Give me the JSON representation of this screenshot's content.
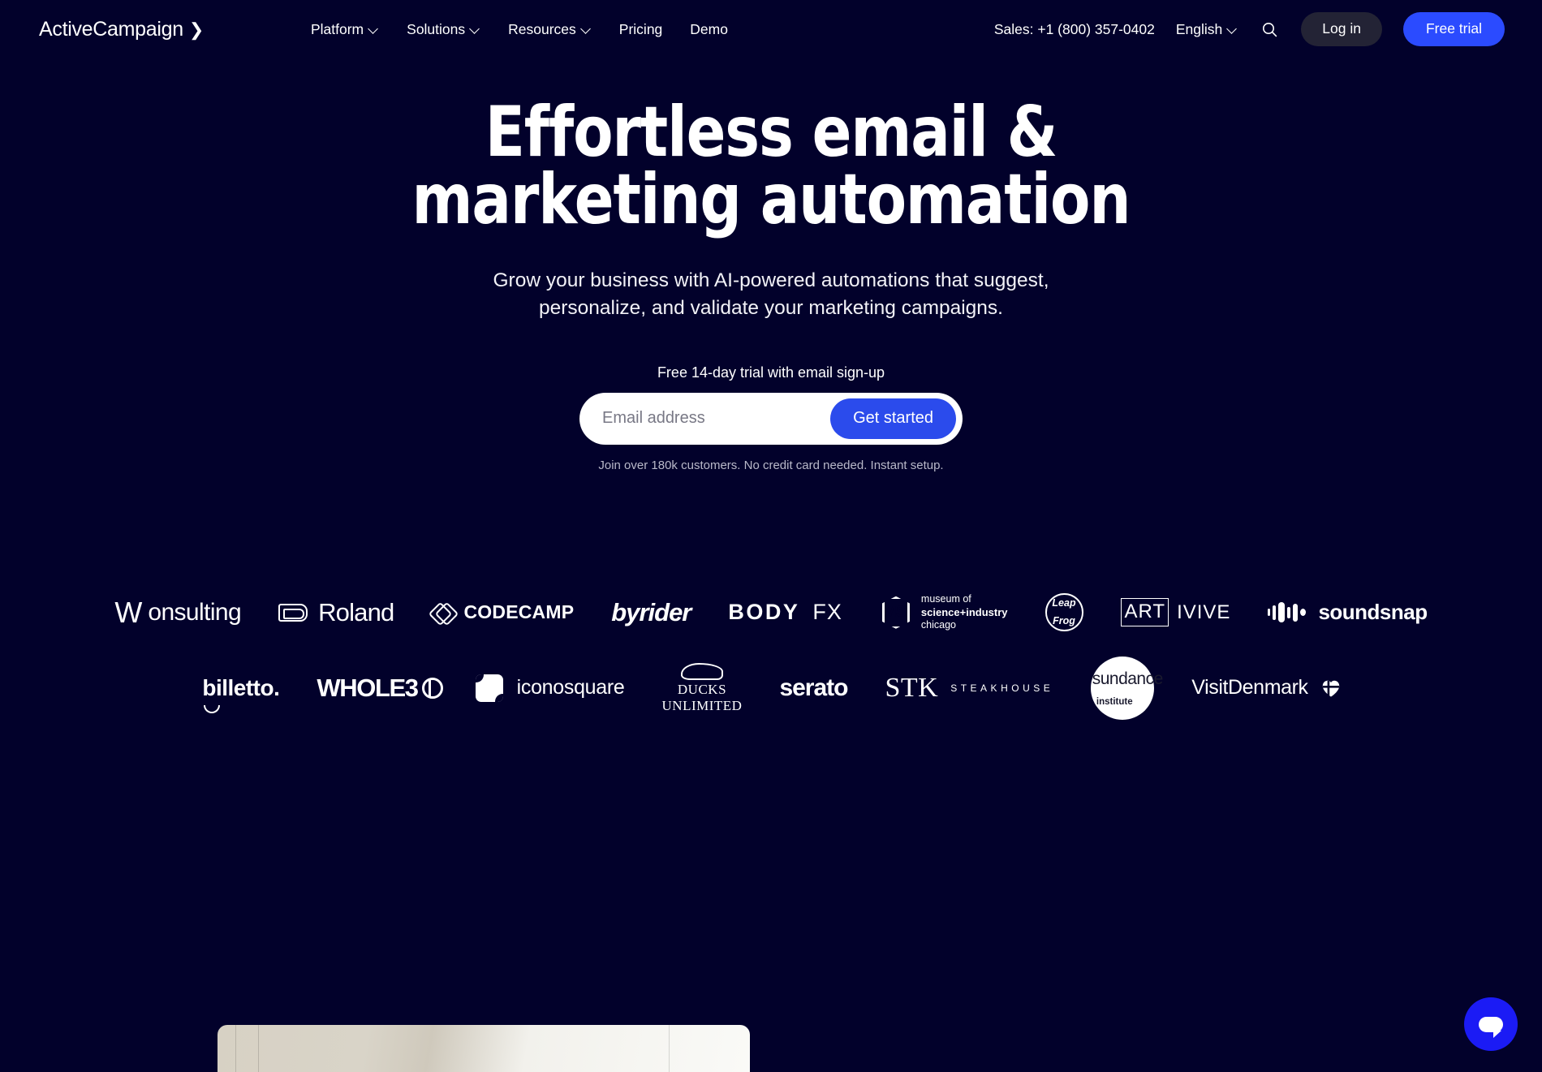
{
  "header": {
    "brand": "ActiveCampaign",
    "brand_chevron": "❯",
    "nav": [
      {
        "label": "Platform",
        "has_caret": true
      },
      {
        "label": "Solutions",
        "has_caret": true
      },
      {
        "label": "Resources",
        "has_caret": true
      },
      {
        "label": "Pricing",
        "has_caret": false
      },
      {
        "label": "Demo",
        "has_caret": false
      }
    ],
    "sales_phone": "Sales: +1 (800) 357-0402",
    "language": "English",
    "search_icon": "search-icon",
    "login_label": "Log in",
    "free_trial_label": "Free trial"
  },
  "hero": {
    "title": "Effortless email & marketing automation",
    "subtitle": "Grow your business with AI-powered automations that suggest, personalize, and validate your marketing campaigns."
  },
  "signup": {
    "label": "Free 14-day trial with email sign-up",
    "email_placeholder": "Email address",
    "email_value": "",
    "cta_label": "Get started",
    "note": "Join over 180k customers. No credit card needed. Instant setup."
  },
  "logo_wall": {
    "row1": [
      {
        "name": "Wonsulting",
        "mark": "W",
        "text": "onsulting"
      },
      {
        "name": "Roland",
        "text": "Roland"
      },
      {
        "name": "CodeCamp",
        "text": "CODECAMP"
      },
      {
        "name": "byrider",
        "text": "byrider"
      },
      {
        "name": "BODY FX",
        "text": "BODY",
        "text2": "FX"
      },
      {
        "name": "museum of science+industry chicago",
        "l1": "museum of",
        "l2": "science+industry",
        "l3": "chicago"
      },
      {
        "name": "Leap Frog",
        "l1": "Leap",
        "l2": "Frog"
      },
      {
        "name": "ARTIVIVE",
        "boxed": "ART",
        "rest": "IVIVE"
      },
      {
        "name": "soundsnap",
        "text": "soundsnap"
      }
    ],
    "row2": [
      {
        "name": "billetto",
        "text": "billetto."
      },
      {
        "name": "WHOLE30",
        "text": "WHOLE3"
      },
      {
        "name": "iconosquare",
        "text": "iconosquare"
      },
      {
        "name": "Ducks Unlimited",
        "l1": "DUCKS",
        "l2": "UNLIMITED"
      },
      {
        "name": "serato",
        "text": "serato"
      },
      {
        "name": "STK Steakhouse",
        "word": "STK",
        "sub": "STEAKHOUSE"
      },
      {
        "name": "sundance institute",
        "l1": "sundance",
        "l2": "institute"
      },
      {
        "name": "VisitDenmark",
        "text": "VisitDenmark"
      }
    ]
  },
  "chat": {
    "icon": "chat-bubble-icon",
    "color": "#1B1BF5"
  },
  "colors": {
    "background": "#02012B",
    "accent_blue": "#2B4BFF",
    "cta_blue": "#2B4BEC",
    "login_pill": "#232335"
  }
}
